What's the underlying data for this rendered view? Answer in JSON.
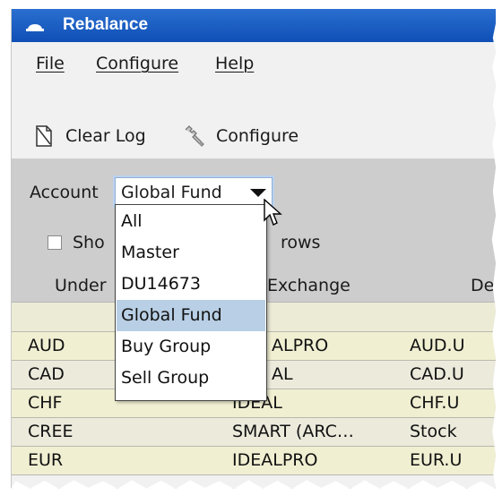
{
  "window": {
    "title": "Rebalance"
  },
  "menu": {
    "file": "File",
    "configure": "Configure",
    "help": "Help"
  },
  "toolbar": {
    "clear_log": "Clear Log",
    "configure": "Configure"
  },
  "account": {
    "label": "Account",
    "selected": "Global Fund",
    "options": [
      "All",
      "Master",
      "DU14673",
      "Global Fund",
      "Buy Group",
      "Sell Group"
    ]
  },
  "filter": {
    "show_prefix": "Sho",
    "show_suffix": "rows"
  },
  "columns": {
    "underlying": "Under",
    "exchange": "Exchange",
    "description": "De"
  },
  "rows": [
    {
      "underlying": "AUD",
      "exchange": "ALPRO",
      "description": "AUD.U"
    },
    {
      "underlying": "CAD",
      "exchange": "AL",
      "description": "CAD.U"
    },
    {
      "underlying": "CHF",
      "exchange": "IDEAL",
      "description": "CHF.U"
    },
    {
      "underlying": "CREE",
      "exchange": "SMART (ARC…",
      "description": "Stock"
    },
    {
      "underlying": "EUR",
      "exchange": "IDEALPRO",
      "description": "EUR.U"
    }
  ],
  "colors": {
    "titlebar": "#1a5cc4",
    "row_background": "#f0efd2",
    "selection": "#b8cfe5"
  },
  "icons": {
    "window": "imperial-hat-icon",
    "clear_log": "page-icon",
    "configure": "wrench-icon"
  }
}
